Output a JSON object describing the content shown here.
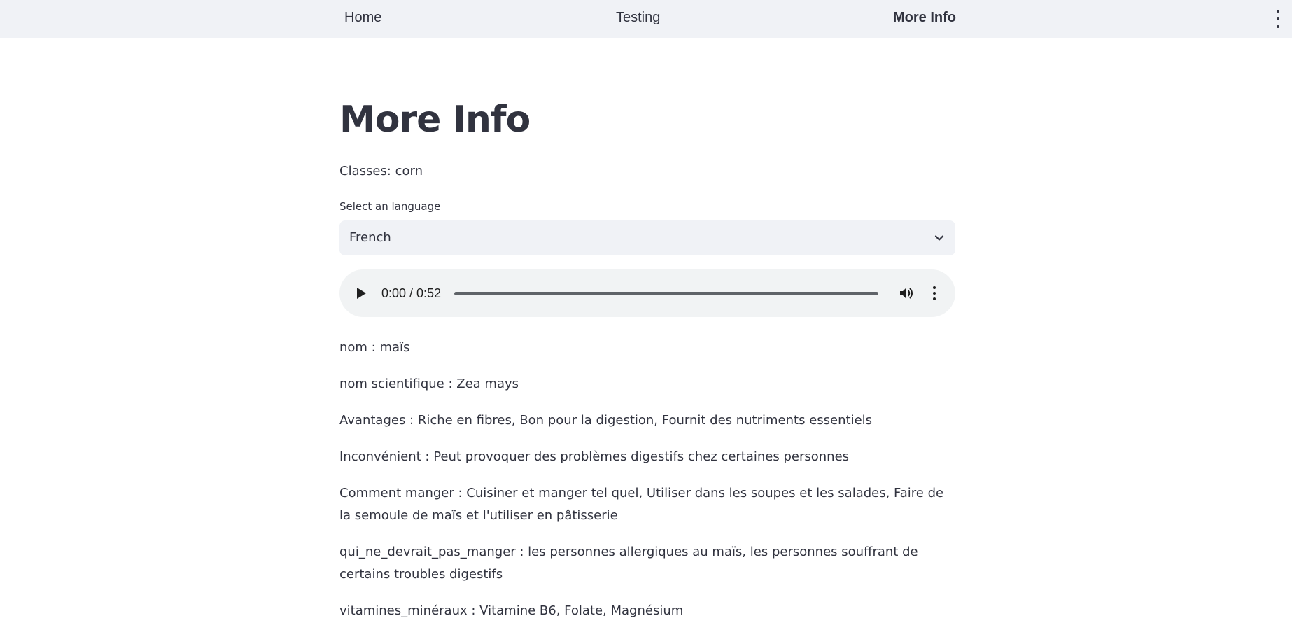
{
  "nav": {
    "items": [
      {
        "label": "Home",
        "active": false
      },
      {
        "label": "Testing",
        "active": false
      },
      {
        "label": "More Info",
        "active": true
      }
    ]
  },
  "page": {
    "title": "More Info",
    "classes": "Classes: corn"
  },
  "language_select": {
    "label": "Select an language",
    "value": "French"
  },
  "audio": {
    "time": "0:00 / 0:52",
    "progress": 0
  },
  "info": [
    "nom : maïs",
    "nom scientifique : Zea mays",
    "Avantages : Riche en fibres, Bon pour la digestion, Fournit des nutriments essentiels",
    "Inconvénient : Peut provoquer des problèmes digestifs chez certaines personnes",
    "Comment manger : Cuisiner et manger tel quel, Utiliser dans les soupes et les salades, Faire de la semoule de maïs et l'utiliser en pâtisserie",
    "qui_ne_devrait_pas_manger : les personnes allergiques au maïs, les personnes souffrant de certains troubles digestifs",
    "vitamines_minéraux : Vitamine B6, Folate, Magnésium"
  ],
  "colors": {
    "nav_background": "#f0f2f6",
    "text": "#31333f",
    "audio_background": "#f1f3f4"
  }
}
